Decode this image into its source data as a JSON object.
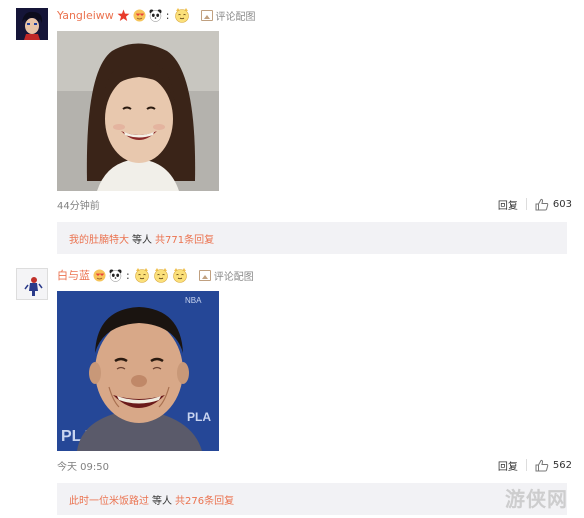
{
  "comments": [
    {
      "username": "Yangleiww",
      "badges": [
        "star-badge",
        "heart-emoji",
        "panda-emoji"
      ],
      "emojis": [
        "cute-face-emoji"
      ],
      "pic_link": "评论配图",
      "time": "44分钟前",
      "reply_label": "回复",
      "likes": "603",
      "sub_reply": {
        "who": "我的肚腩特大",
        "etc": "等人",
        "total": "共771条回复"
      }
    },
    {
      "username": "白与蓝",
      "badges": [
        "heart-emoji",
        "panda-emoji"
      ],
      "emojis": [
        "cute-face-emoji",
        "cute-face-emoji",
        "cute-face-emoji"
      ],
      "pic_link": "评论配图",
      "time": "今天 09:50",
      "reply_label": "回复",
      "likes": "562",
      "sub_reply": {
        "who": "此时一位米饭路过",
        "etc": "等人",
        "total": "共276条回复"
      }
    }
  ],
  "colors": {
    "username": "#eb7350",
    "subreply_bg": "#f2f2f5",
    "meta": "#808080"
  },
  "watermark": "游侠网"
}
